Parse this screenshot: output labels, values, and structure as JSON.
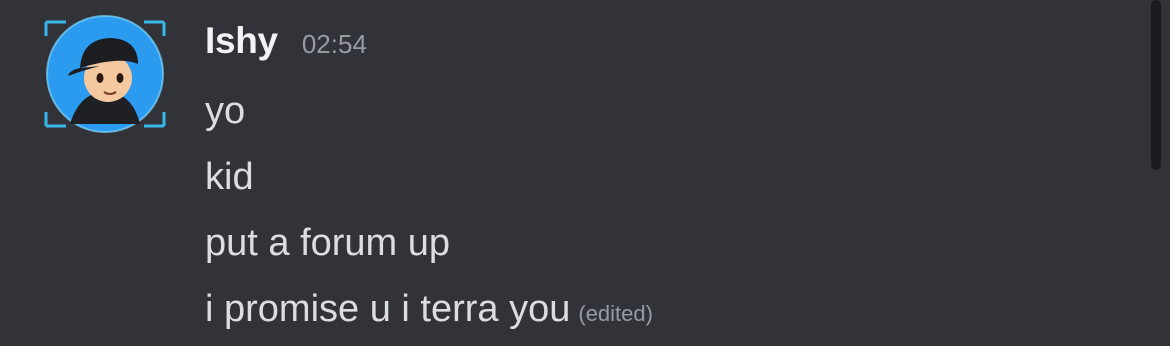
{
  "message": {
    "author": "Ishy",
    "timestamp": "02:54",
    "avatar_icon": "user-avatar-icon",
    "lines": [
      {
        "text": "yo",
        "edited": ""
      },
      {
        "text": "kid",
        "edited": ""
      },
      {
        "text": "put a forum up",
        "edited": ""
      },
      {
        "text": "i promise u i terra you",
        "edited": "(edited)"
      }
    ]
  },
  "colors": {
    "background": "#313338",
    "username": "#f2f3f5",
    "text": "#dbdee1",
    "muted": "#949ba4",
    "avatar_ring": "#2b9bf0"
  }
}
